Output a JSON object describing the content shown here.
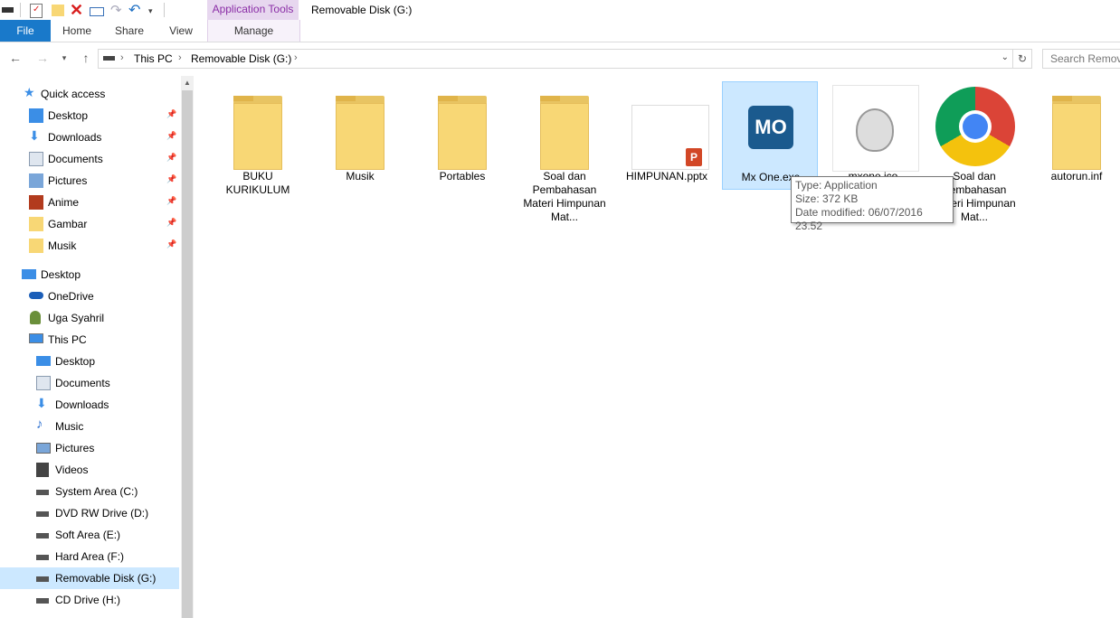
{
  "window": {
    "title": "Removable Disk (G:)",
    "context_tab_group": "Application Tools"
  },
  "ribbon": {
    "tabs": [
      "File",
      "Home",
      "Share",
      "View",
      "Manage"
    ]
  },
  "address": {
    "crumbs": [
      "This PC",
      "Removable Disk (G:)"
    ],
    "search_placeholder": "Search Removable Disk (G:)"
  },
  "nav": {
    "quick_access": "Quick access",
    "quick_items": [
      {
        "label": "Desktop",
        "icon": "desktop-icon"
      },
      {
        "label": "Downloads",
        "icon": "downloads-icon"
      },
      {
        "label": "Documents",
        "icon": "documents-icon"
      },
      {
        "label": "Pictures",
        "icon": "pictures-icon"
      },
      {
        "label": "Anime",
        "icon": "anime-folder-icon"
      },
      {
        "label": "Gambar",
        "icon": "folder-icon"
      },
      {
        "label": "Musik",
        "icon": "folder-icon"
      }
    ],
    "desktop": "Desktop",
    "onedrive": "OneDrive",
    "user": "Uga Syahril",
    "this_pc": "This PC",
    "pc_items": [
      {
        "label": "Desktop",
        "icon": "desktop-icon"
      },
      {
        "label": "Documents",
        "icon": "documents-icon"
      },
      {
        "label": "Downloads",
        "icon": "downloads-icon"
      },
      {
        "label": "Music",
        "icon": "music-icon"
      },
      {
        "label": "Pictures",
        "icon": "pictures-icon"
      },
      {
        "label": "Videos",
        "icon": "videos-icon"
      },
      {
        "label": "System Area (C:)",
        "icon": "system-drive-icon"
      },
      {
        "label": "DVD RW Drive (D:)",
        "icon": "dvd-drive-icon"
      },
      {
        "label": "Soft Area (E:)",
        "icon": "drive-icon"
      },
      {
        "label": "Hard Area (F:)",
        "icon": "drive-icon"
      },
      {
        "label": "Removable Disk (G:)",
        "icon": "removable-drive-icon"
      },
      {
        "label": "CD Drive (H:)",
        "icon": "cd-drive-icon"
      }
    ]
  },
  "files": [
    {
      "name": "BUKU KURIKULUM",
      "kind": "folder"
    },
    {
      "name": "Musik",
      "kind": "folder"
    },
    {
      "name": "Portables",
      "kind": "folder"
    },
    {
      "name": "Soal dan Pembahasan Materi Himpunan Mat...",
      "kind": "folder"
    },
    {
      "name": "HIMPUNAN.pptx",
      "kind": "pptx"
    },
    {
      "name": "Mx One.exe",
      "kind": "exe"
    },
    {
      "name": "mxone.ico",
      "kind": "ico"
    },
    {
      "name": "Soal dan Pembahasan Materi Himpunan Mat...",
      "kind": "chrome"
    },
    {
      "name": "autorun.inf",
      "kind": "folder"
    }
  ],
  "mx_logo_text": "MO",
  "tooltip": {
    "type": "Type: Application",
    "size": "Size: 372 KB",
    "date": "Date modified: 06/07/2016 23.52"
  },
  "colors": {
    "file_tab": "#1979ca",
    "selection": "#cce8ff",
    "folder": "#f8d775",
    "context_tab": "#8a2da6"
  }
}
